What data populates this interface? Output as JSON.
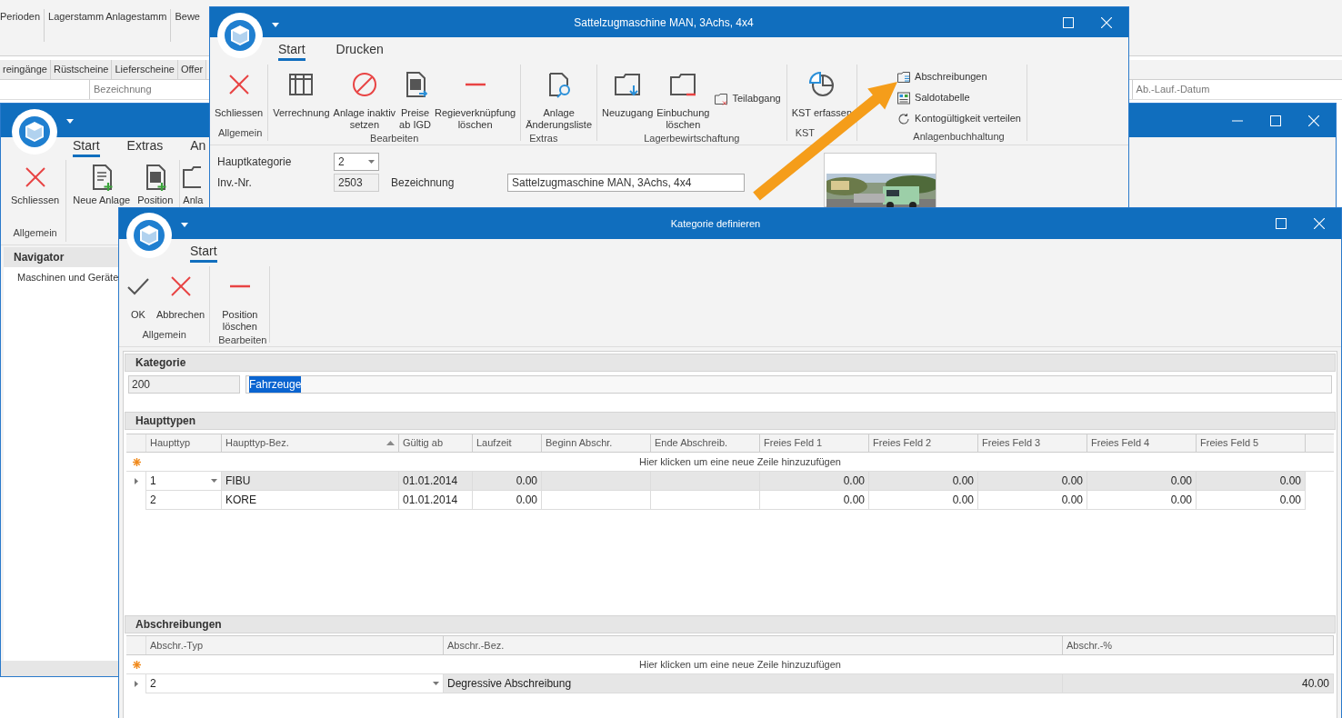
{
  "background_app": {
    "ribbon_items": [
      "Perioden",
      "Lagerstamm",
      "Anlagestamm",
      "Bewe"
    ],
    "tabs": [
      "reingänge",
      "Rüstscheine",
      "Lieferscheine",
      "Offer"
    ],
    "columns": [
      "Bezeichnung",
      "Ab.-Lauf.-Datum"
    ]
  },
  "asset_window": {
    "tabs": [
      {
        "label": "Start",
        "selected": true
      },
      {
        "label": "Extras",
        "selected": false
      },
      {
        "label": "An",
        "selected": false
      }
    ],
    "ribbon_groups": [
      {
        "label": "Allgemein",
        "buttons": [
          {
            "kind": "close",
            "label": "Schliessen"
          }
        ]
      },
      {
        "buttons": [
          {
            "kind": "doc_plus",
            "label": "Neue Anlage"
          },
          {
            "kind": "calc_plus",
            "label": "Position"
          }
        ]
      },
      {
        "buttons": [
          {
            "kind": "folder",
            "label": "Anla"
          }
        ]
      }
    ],
    "navigator": {
      "title": "Navigator",
      "items": [
        {
          "label": "Maschinen und Geräte"
        }
      ]
    }
  },
  "asset_detail_window": {
    "title": "Sattelzugmaschine MAN, 3Achs, 4x4",
    "tabs": [
      {
        "label": "Start",
        "selected": true
      },
      {
        "label": "Drucken",
        "selected": false
      }
    ],
    "ribbon_groups": [
      {
        "label": "Allgemein",
        "buttons": [
          {
            "kind": "close",
            "label": "Schliessen"
          }
        ]
      },
      {
        "label": "Bearbeiten",
        "buttons": [
          {
            "kind": "columns",
            "label": "Verrechnung"
          },
          {
            "kind": "block",
            "label": "Anlage inaktiv\nsetzen"
          },
          {
            "kind": "calc_export",
            "label": "Preise\nab IGD"
          },
          {
            "kind": "minus",
            "label": "Regieverknüpfung\nlöschen"
          }
        ]
      },
      {
        "label": "Extras",
        "buttons": [
          {
            "kind": "doc_search",
            "label": "Anlage\nÄnderungsliste"
          }
        ]
      },
      {
        "label": "Lagerbewirtschaftung",
        "buttons": [
          {
            "kind": "folder_in",
            "label": "Neuzugang"
          },
          {
            "kind": "folder_minus",
            "label": "Einbuchung\nlöschen"
          }
        ],
        "small_buttons": [
          {
            "kind": "folder_x",
            "label": "Teilabgang"
          }
        ]
      },
      {
        "label": "KST",
        "buttons": [
          {
            "kind": "pie",
            "label": "KST erfassen"
          }
        ]
      },
      {
        "label": "Anlagenbuchhaltung",
        "small_buttons": [
          {
            "kind": "list",
            "label": "Abschreibungen"
          },
          {
            "kind": "table",
            "label": "Saldotabelle"
          },
          {
            "kind": "refresh",
            "label": "Kontogültigkeit verteilen"
          }
        ]
      }
    ],
    "form": {
      "hauptkategorie": {
        "label": "Hauptkategorie",
        "value": "2"
      },
      "inv_nr": {
        "label": "Inv.-Nr.",
        "value": "2503"
      },
      "bezeichnung": {
        "label": "Bezeichnung",
        "value": "Sattelzugmaschine MAN, 3Achs, 4x4"
      }
    }
  },
  "category_dialog": {
    "title": "Kategorie definieren",
    "tabs": [
      {
        "label": "Start",
        "selected": true
      }
    ],
    "ribbon_groups": [
      {
        "label": "Allgemein",
        "buttons": [
          {
            "kind": "check",
            "label": "OK"
          },
          {
            "kind": "close",
            "label": "Abbrechen"
          }
        ]
      },
      {
        "label": "Bearbeiten",
        "buttons": [
          {
            "kind": "minus",
            "label": "Position\nlöschen"
          }
        ]
      }
    ],
    "kategorie": {
      "title": "Kategorie",
      "number": "200",
      "name": "Fahrzeuge",
      "name_selected": true
    },
    "haupttypen": {
      "title": "Haupttypen",
      "new_row_hint": "Hier klicken um eine neue Zeile hinzuzufügen",
      "columns": [
        {
          "label": "Haupttyp"
        },
        {
          "label": "Haupttyp-Bez.",
          "sorted": true
        },
        {
          "label": "Gültig ab"
        },
        {
          "label": "Laufzeit"
        },
        {
          "label": "Beginn Abschr."
        },
        {
          "label": "Ende Abschreib."
        },
        {
          "label": "Freies Feld 1"
        },
        {
          "label": "Freies Feld 2"
        },
        {
          "label": "Freies Feld 3"
        },
        {
          "label": "Freies Feld 4"
        },
        {
          "label": "Freies Feld 5"
        }
      ],
      "rows": [
        {
          "selected": true,
          "haupttyp": "1",
          "bezeichnung": "FIBU",
          "gueltig_ab": "01.01.2014",
          "laufzeit": "0.00",
          "freie_felder": [
            "0.00",
            "0.00",
            "0.00",
            "0.00",
            "0.00"
          ]
        },
        {
          "selected": false,
          "haupttyp": "2",
          "bezeichnung": "KORE",
          "gueltig_ab": "01.01.2014",
          "laufzeit": "0.00",
          "freie_felder": [
            "0.00",
            "0.00",
            "0.00",
            "0.00",
            "0.00"
          ]
        }
      ]
    },
    "abschreibungen": {
      "title": "Abschreibungen",
      "new_row_hint": "Hier klicken um eine neue Zeile hinzuzufügen",
      "columns": [
        {
          "label": "Abschr.-Typ"
        },
        {
          "label": "Abschr.-Bez."
        },
        {
          "label": "Abschr.-%"
        }
      ],
      "rows": [
        {
          "selected": true,
          "typ": "2",
          "bezeichnung": "Degressive Abschreibung",
          "prozent": "40.00"
        }
      ]
    }
  }
}
